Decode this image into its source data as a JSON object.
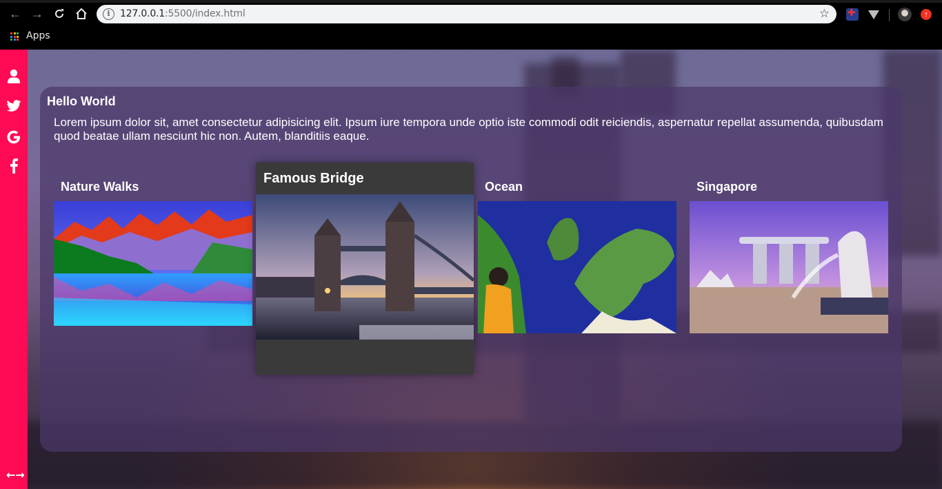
{
  "browser": {
    "url_host": "127.0.0.1",
    "url_rest": ":5500/index.html",
    "bookmarks_label": "Apps"
  },
  "sidebar": {
    "icons": [
      "user-icon",
      "twitter-icon",
      "google-icon",
      "facebook-icon"
    ],
    "bottom_icon": "expand-arrows-icon",
    "bottom_glyph": "←→",
    "color": "#ff0a54"
  },
  "panel": {
    "title": "Hello World",
    "text": "Lorem ipsum dolor sit, amet consectetur adipisicing elit. Ipsum iure tempora unde optio iste commodi odit reiciendis, aspernatur repellat assumenda, quibusdam quod beatae ullam nesciunt hic non. Autem, blanditiis eaque."
  },
  "cards": [
    {
      "title": "Nature Walks"
    },
    {
      "title": "Famous Bridge"
    },
    {
      "title": "Ocean"
    },
    {
      "title": "Singapore"
    }
  ]
}
